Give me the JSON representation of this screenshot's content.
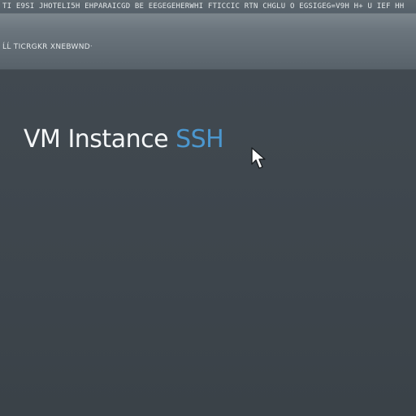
{
  "window": {
    "top_strip_text": "TI  E9SI  JHOTELI5H  EHPARAICGD  BE  EEGEGEHERWHI  FTICCIC RTN  CHGLU  O  EGSIGEG=V9H  H+  U  IEF  HH"
  },
  "header": {
    "breadcrumb": "ĹĹ  TICRGKR  XNEBWNDᐧ"
  },
  "main": {
    "title_primary": "VM Instance ",
    "title_accent": "SSH"
  },
  "icons": {
    "pointer": "mouse-pointer-icon"
  },
  "colors": {
    "accent": "#4b97cf",
    "background": "#3c444b",
    "header": "#6b757d",
    "title_text": "#f4f6f7"
  }
}
